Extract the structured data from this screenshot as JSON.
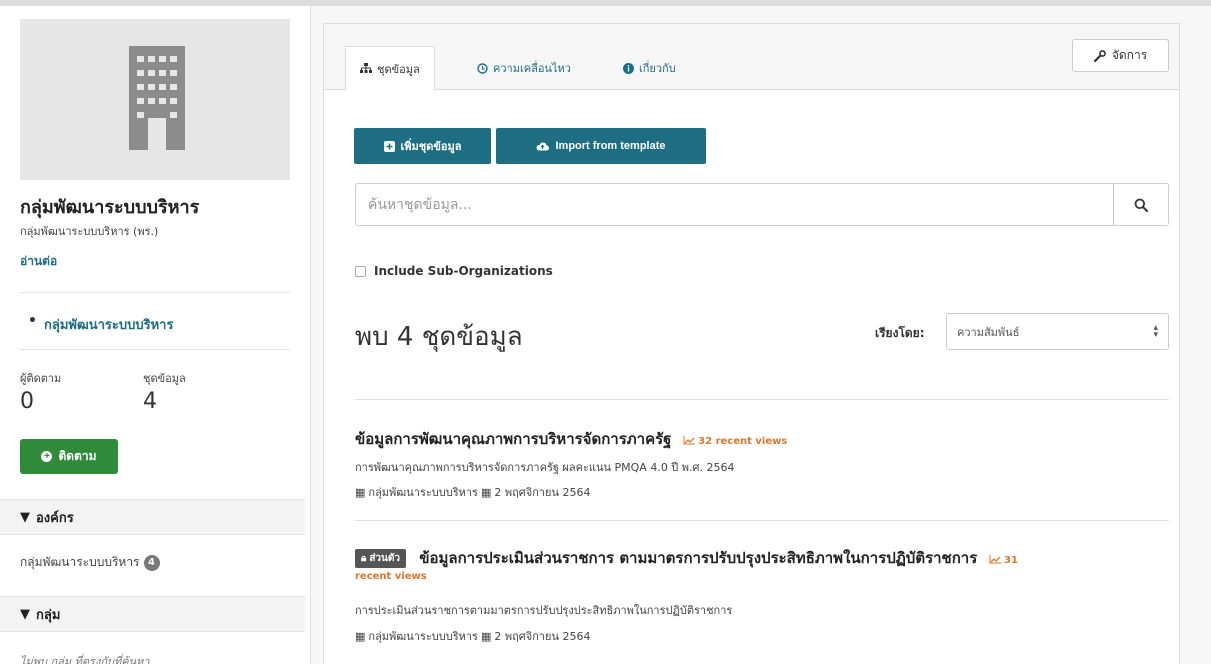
{
  "sidebar": {
    "org_name": "กลุ่มพัฒนาระบบบริหาร",
    "org_subtitle": "กลุ่มพัฒนาระบบบริหาร (พร.)",
    "read_more": "อ่านต่อ",
    "tree_item": "กลุ่มพัฒนาระบบบริหาร",
    "followers_label": "ผู้ติดตาม",
    "followers_value": "0",
    "datasets_label": "ชุดข้อมูล",
    "datasets_value": "4",
    "follow_button": "ติดตาม",
    "facet_org_title": "องค์กร",
    "facet_org_item": "กลุ่มพัฒนาระบบบริหาร",
    "facet_org_count": "4",
    "facet_group_title": "กลุ่ม",
    "facet_group_empty": "ไม่พบ กลุ่ม ที่ตรงกับที่ค้นหา"
  },
  "tabs": [
    {
      "label": "ชุดข้อมูล",
      "icon": "sitemap-icon"
    },
    {
      "label": "ความเคลื่อนไหว",
      "icon": "clock-icon"
    },
    {
      "label": "เกี่ยวกับ",
      "icon": "info-icon"
    }
  ],
  "manage_button": "จัดการ",
  "add_dataset_button": "เพิ่มชุดข้อมูล",
  "import_button": "Import from template",
  "search": {
    "placeholder": "ค้นหาชุดข้อมูล..."
  },
  "include_sub_orgs": "Include Sub-Organizations",
  "results_title": "พบ 4 ชุดข้อมูล",
  "sort": {
    "label": "เรียงโดย:",
    "selected": "ความสัมพันธ์"
  },
  "datasets": [
    {
      "title": "ข้อมูลการพัฒนาคุณภาพการบริหารจัดการภาครัฐ",
      "views": "32 recent views",
      "description": "การพัฒนาคุณภาพการบริหารจัดการภาครัฐ ผลคะแนน PMQA 4.0 ปี พ.ศ. 2564",
      "org": "กลุ่มพัฒนาระบบบริหาร",
      "date": "2 พฤศจิกายน 2564"
    },
    {
      "private_label": "ส่วนตัว",
      "title": "ข้อมูลการประเมินส่วนราชการ ตามมาตรการปรับปรุงประสิทธิภาพในการปฏิบัติราชการ",
      "views_num": "31",
      "views_rest": "recent views",
      "description": "การประเมินส่วนราชการตามมาตรการปรับปรุงประสิทธิภาพในการปฏิบัติราชการ",
      "org": "กลุ่มพัฒนาระบบบริหาร",
      "date": "2 พฤศจิกายน 2564"
    }
  ],
  "colors": {
    "primary": "#1d6e83",
    "follow": "#2f8b39",
    "views": "#e0752b"
  }
}
